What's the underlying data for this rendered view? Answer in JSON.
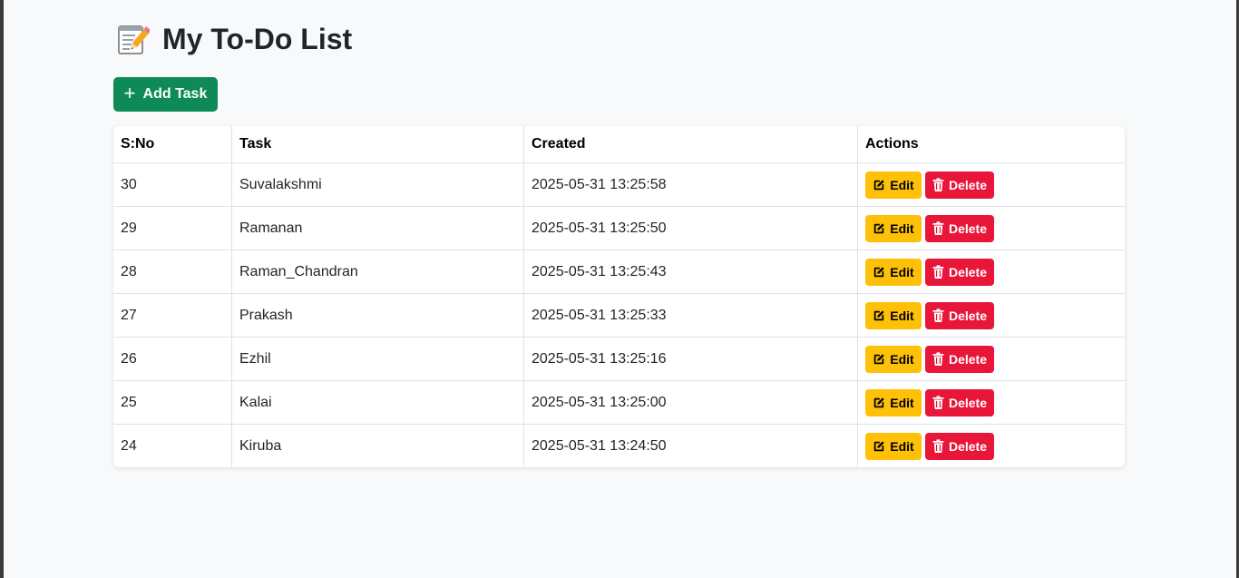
{
  "page": {
    "title_emoji": "📝",
    "title": "My To-Do List"
  },
  "toolbar": {
    "add_label": "Add Task"
  },
  "table": {
    "headers": [
      "S:No",
      "Task",
      "Created",
      "Actions"
    ],
    "rows": [
      {
        "sno": "30",
        "task": "Suvalakshmi",
        "created": "2025-05-31 13:25:58"
      },
      {
        "sno": "29",
        "task": "Ramanan",
        "created": "2025-05-31 13:25:50"
      },
      {
        "sno": "28",
        "task": "Raman_Chandran",
        "created": "2025-05-31 13:25:43"
      },
      {
        "sno": "27",
        "task": "Prakash",
        "created": "2025-05-31 13:25:33"
      },
      {
        "sno": "26",
        "task": "Ezhil",
        "created": "2025-05-31 13:25:16"
      },
      {
        "sno": "25",
        "task": "Kalai",
        "created": "2025-05-31 13:25:00"
      },
      {
        "sno": "24",
        "task": "Kiruba",
        "created": "2025-05-31 13:24:50"
      }
    ],
    "edit_label": "Edit",
    "delete_label": "Delete"
  },
  "icons": {
    "add": "plus-icon",
    "edit": "edit-icon",
    "delete": "trash-icon",
    "title": "memo-icon"
  },
  "colors": {
    "add_button": "#0d8a55",
    "edit_button": "#ffc107",
    "delete_button": "#e8173a",
    "page_bg": "#f8f9fa"
  }
}
